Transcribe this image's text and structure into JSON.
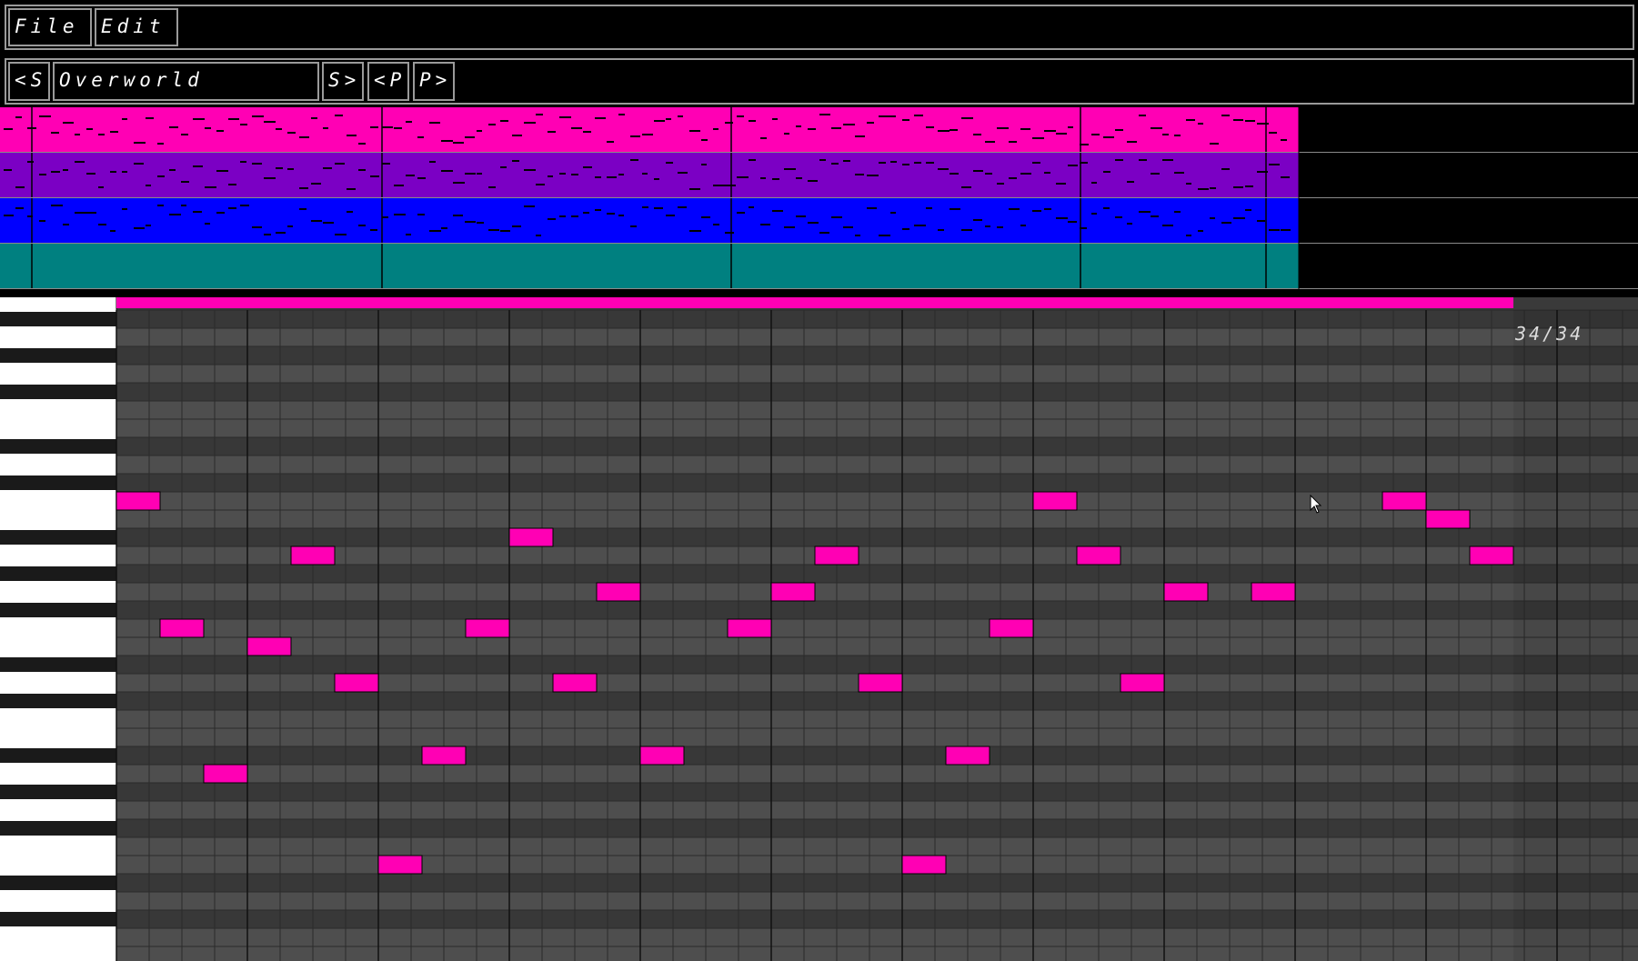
{
  "menu": {
    "file_label": "File",
    "edit_label": "Edit"
  },
  "song_bar": {
    "prev_song_label": "<S",
    "song_name": "Overworld",
    "next_song_label": "S>",
    "prev_pattern_label": "<P",
    "next_pattern_label": "P>"
  },
  "arranger": {
    "tracks": [
      {
        "name": "pink",
        "color": "#ff00b4",
        "has_notes": true
      },
      {
        "name": "purple",
        "color": "#7b00c4",
        "has_notes": true
      },
      {
        "name": "blue",
        "color": "#0000ff",
        "has_notes": true
      },
      {
        "name": "teal",
        "color": "#008080",
        "has_notes": false
      }
    ]
  },
  "piano_roll": {
    "note_color": "#ff00b4",
    "bar_counter": "34/34",
    "notes": [
      {
        "step": 0,
        "pitch": 10
      },
      {
        "step": 1,
        "pitch": 17
      },
      {
        "step": 2,
        "pitch": 25
      },
      {
        "step": 3,
        "pitch": 18
      },
      {
        "step": 4,
        "pitch": 13
      },
      {
        "step": 5,
        "pitch": 20
      },
      {
        "step": 6,
        "pitch": 30
      },
      {
        "step": 7,
        "pitch": 24
      },
      {
        "step": 8,
        "pitch": 17
      },
      {
        "step": 9,
        "pitch": 12
      },
      {
        "step": 10,
        "pitch": 20
      },
      {
        "step": 11,
        "pitch": 15
      },
      {
        "step": 12,
        "pitch": 24
      },
      {
        "step": 14,
        "pitch": 17
      },
      {
        "step": 15,
        "pitch": 15
      },
      {
        "step": 16,
        "pitch": 13
      },
      {
        "step": 17,
        "pitch": 20
      },
      {
        "step": 18,
        "pitch": 30
      },
      {
        "step": 19,
        "pitch": 24
      },
      {
        "step": 20,
        "pitch": 17
      },
      {
        "step": 21,
        "pitch": 10
      },
      {
        "step": 22,
        "pitch": 13
      },
      {
        "step": 23,
        "pitch": 20
      },
      {
        "step": 24,
        "pitch": 15
      },
      {
        "step": 26,
        "pitch": 15
      },
      {
        "step": 29,
        "pitch": 10
      },
      {
        "step": 30,
        "pitch": 11
      },
      {
        "step": 31,
        "pitch": 13
      }
    ]
  }
}
